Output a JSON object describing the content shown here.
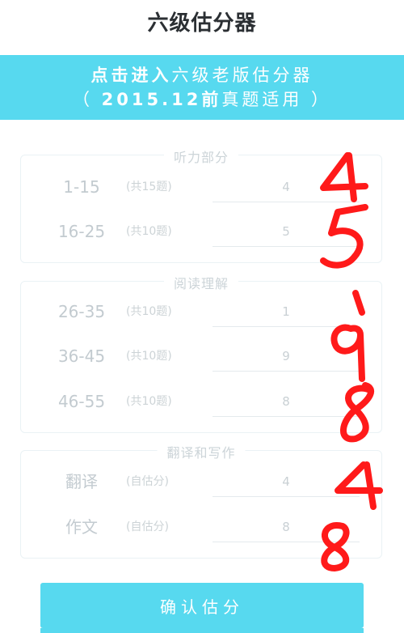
{
  "header": {
    "title": "六级估分器"
  },
  "banner": {
    "line1_bold": "点击进入",
    "line1_rest": "六级老版估分器",
    "line2_open": "（ ",
    "line2_bold": "2015.12前",
    "line2_rest": "真题适用 ）"
  },
  "sections": [
    {
      "title": "听力部分",
      "rows": [
        {
          "range": "1-15",
          "note": "(共15题)",
          "value": "4"
        },
        {
          "range": "16-25",
          "note": "(共10题)",
          "value": "5"
        }
      ]
    },
    {
      "title": "阅读理解",
      "rows": [
        {
          "range": "26-35",
          "note": "(共10题)",
          "value": "1"
        },
        {
          "range": "36-45",
          "note": "(共10题)",
          "value": "9"
        },
        {
          "range": "46-55",
          "note": "(共10题)",
          "value": "8"
        }
      ]
    },
    {
      "title": "翻译和写作",
      "rows": [
        {
          "range": "翻译",
          "note": "(自估分)",
          "value": "4"
        },
        {
          "range": "作文",
          "note": "(自估分)",
          "value": "8"
        }
      ]
    }
  ],
  "confirm": {
    "label": "确认估分"
  },
  "colors": {
    "accent": "#57d9ef",
    "annotation": "#ff1a1a"
  }
}
